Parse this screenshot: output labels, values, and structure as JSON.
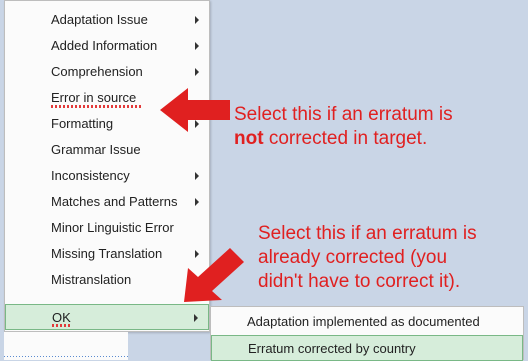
{
  "menu": {
    "items": [
      {
        "label": "Adaptation Issue",
        "submenu": true
      },
      {
        "label": "Added Information",
        "submenu": true
      },
      {
        "label": "Comprehension",
        "submenu": true
      },
      {
        "label": "Error in source",
        "submenu": false
      },
      {
        "label": "Formatting",
        "submenu": true
      },
      {
        "label": "Grammar Issue",
        "submenu": false
      },
      {
        "label": "Inconsistency",
        "submenu": true
      },
      {
        "label": "Matches and Patterns",
        "submenu": true
      },
      {
        "label": "Minor Linguistic Error",
        "submenu": false
      },
      {
        "label": "Missing Translation",
        "submenu": true
      },
      {
        "label": "Mistranslation",
        "submenu": false
      },
      {
        "label": "OK",
        "submenu": true,
        "selected": true
      }
    ]
  },
  "submenu": {
    "items": [
      {
        "label": "Adaptation implemented as documented"
      },
      {
        "label": "Erratum corrected by country",
        "highlighted": true
      }
    ]
  },
  "annotations": {
    "callout1": {
      "line1": "Select this if an erratum is",
      "bold": "not",
      "line2_rest": " corrected in target."
    },
    "callout2": {
      "line1": "Select this if an erratum is",
      "line2": "already corrected (you",
      "line3": "didn't have to correct it)."
    },
    "color": "#e02020"
  },
  "colors": {
    "background": "#c9d5e6",
    "menu_bg": "#fbfbfb",
    "selected_bg": "#d6edda",
    "selected_border": "#79b886"
  }
}
